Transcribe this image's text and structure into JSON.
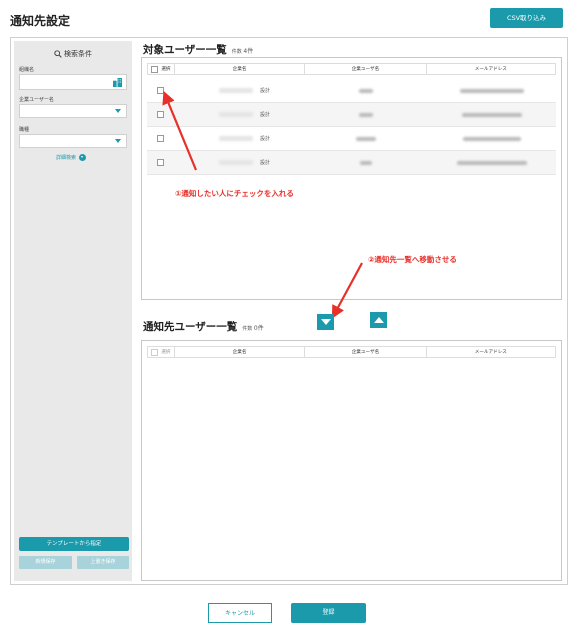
{
  "page": {
    "title": "通知先設定"
  },
  "header": {
    "csv_button": "CSV取り込み"
  },
  "sidebar": {
    "search_heading": "検索条件",
    "fields": [
      {
        "label": "組織名",
        "value": "",
        "icon": "building-icon"
      },
      {
        "label": "企業ユーザー名",
        "value": ""
      },
      {
        "label": "職種",
        "value": ""
      }
    ],
    "detail_link": "詳細検索",
    "template_button": "テンプレートから指定",
    "new_save_button": "新規保存",
    "overwrite_save_button": "上書き保存"
  },
  "target_users": {
    "title": "対象ユーザー一覧",
    "count_label": "件数",
    "count_value": "4件",
    "columns": [
      "選択",
      "企業名",
      "企業ユーザ名",
      "メールアドレス"
    ],
    "rows": [
      {
        "dept": "設計",
        "checked": false
      },
      {
        "dept": "設計",
        "checked": false
      },
      {
        "dept": "設計",
        "checked": false
      },
      {
        "dept": "設計",
        "checked": false
      }
    ]
  },
  "notify_users": {
    "title": "通知先ユーザー一覧",
    "count_label": "件数",
    "count_value": "0件",
    "columns": [
      "選択",
      "企業名",
      "企業ユーザ名",
      "メールアドレス"
    ]
  },
  "annotations": {
    "step1": "①通知したい人にチェックを入れる",
    "step2": "②通知先一覧へ移動させる"
  },
  "footer": {
    "cancel_button": "キャンセル",
    "submit_button": "登録"
  },
  "colors": {
    "accent": "#1a9aab",
    "annotation": "#e8302a",
    "sidebar_bg": "#e9e9e9"
  }
}
